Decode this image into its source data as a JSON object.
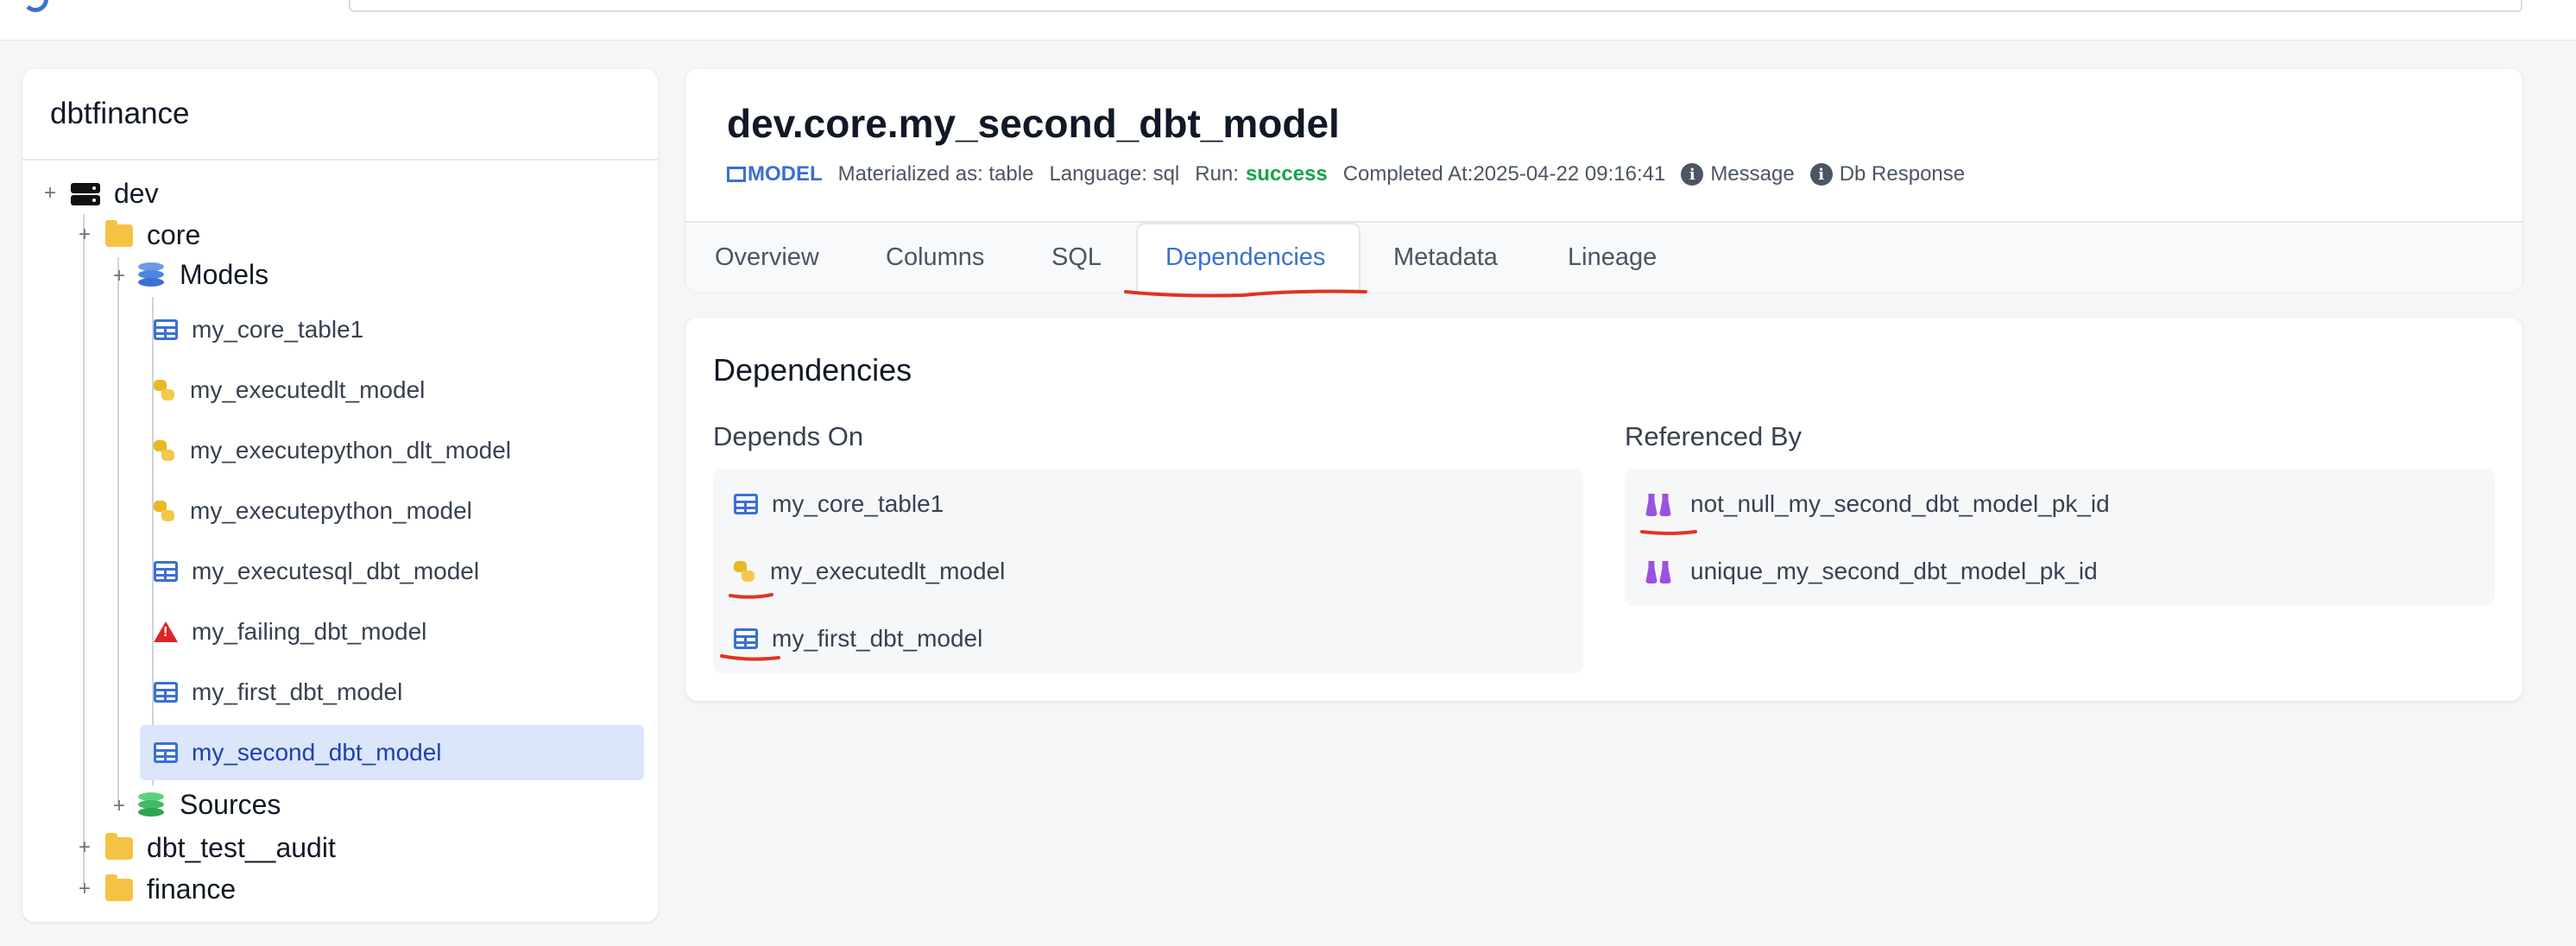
{
  "sidebar": {
    "project": "dbtfinance",
    "tree": {
      "dev": "dev",
      "core": "core",
      "models": "Models",
      "items": [
        {
          "label": "my_core_table1",
          "icon": "table-icon"
        },
        {
          "label": "my_executedlt_model",
          "icon": "python-icon"
        },
        {
          "label": "my_executepython_dlt_model",
          "icon": "python-icon"
        },
        {
          "label": "my_executepython_model",
          "icon": "python-icon"
        },
        {
          "label": "my_executesql_dbt_model",
          "icon": "table-icon"
        },
        {
          "label": "my_failing_dbt_model",
          "icon": "warning-icon"
        },
        {
          "label": "my_first_dbt_model",
          "icon": "table-icon"
        },
        {
          "label": "my_second_dbt_model",
          "icon": "table-icon",
          "selected": true
        }
      ],
      "sources": "Sources",
      "dbt_test_audit": "dbt_test__audit",
      "finance": "finance"
    }
  },
  "header": {
    "title": "dev.core.my_second_dbt_model",
    "type_badge": "MODEL",
    "materialized": "Materialized as: table",
    "language": "Language: sql",
    "run_label": "Run:",
    "run_status": "success",
    "completed": "Completed At:2025-04-22 09:16:41",
    "message": "Message",
    "db_response": "Db Response"
  },
  "tabs": [
    "Overview",
    "Columns",
    "SQL",
    "Dependencies",
    "Metadata",
    "Lineage"
  ],
  "active_tab": "Dependencies",
  "dependencies": {
    "title": "Dependencies",
    "depends_on_title": "Depends On",
    "depends_on": [
      {
        "label": "my_core_table1",
        "icon": "table-icon"
      },
      {
        "label": "my_executedlt_model",
        "icon": "python-icon"
      },
      {
        "label": "my_first_dbt_model",
        "icon": "table-icon"
      }
    ],
    "referenced_by_title": "Referenced By",
    "referenced_by": [
      {
        "label": "not_null_my_second_dbt_model_pk_id",
        "icon": "test-flask-icon"
      },
      {
        "label": "unique_my_second_dbt_model_pk_id",
        "icon": "test-flask-icon"
      }
    ]
  },
  "colors": {
    "accent": "#3b6fd4",
    "success": "#16a34a",
    "annotation": "#e0341f",
    "selected_bg": "#dbe6fb"
  }
}
